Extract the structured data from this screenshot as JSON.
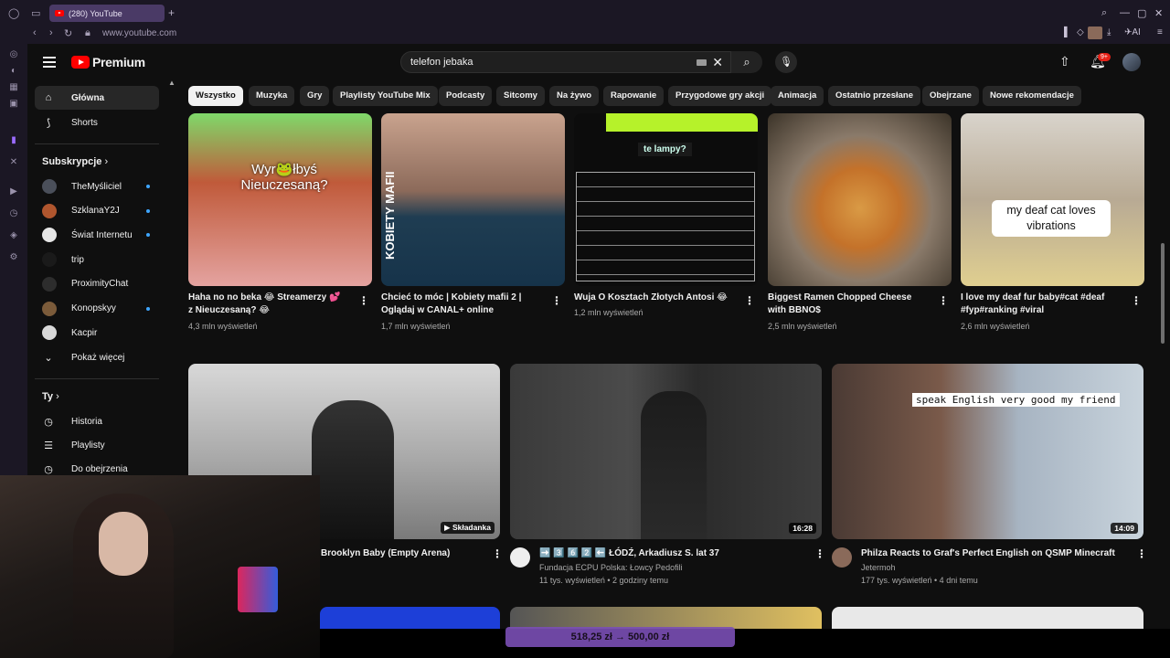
{
  "browser": {
    "tab_title": "(280) YouTube",
    "new_tab": "+",
    "url": "www.youtube.com",
    "ai_label": "AI"
  },
  "header": {
    "logo_text": "Premium",
    "search_value": "telefon jebaka",
    "notifications_badge": "9+"
  },
  "sidebar": {
    "items": [
      {
        "label": "Główna",
        "icon": "home-icon"
      },
      {
        "label": "Shorts",
        "icon": "shorts-icon"
      }
    ],
    "subscriptions_heading": "Subskrypcje",
    "subscriptions": [
      {
        "label": "TheMyśliciel",
        "color": "#4a4f5a",
        "dot": true
      },
      {
        "label": "SzklanaY2J",
        "color": "#b0562e",
        "dot": true
      },
      {
        "label": "Świat Internetu",
        "color": "#e6e6e6",
        "dot": true
      },
      {
        "label": "trip",
        "color": "#1a1a1a",
        "dot": false
      },
      {
        "label": "ProximityChat",
        "color": "#2d2d2d",
        "dot": false
      },
      {
        "label": "Konopskyy",
        "color": "#7b5b3a",
        "dot": true
      },
      {
        "label": "Kacpir",
        "color": "#d8d8d8",
        "dot": false
      }
    ],
    "show_more": "Pokaż więcej",
    "you_heading": "Ty",
    "you_items": [
      {
        "label": "Historia"
      },
      {
        "label": "Playlisty"
      },
      {
        "label": "Do obejrzenia"
      }
    ]
  },
  "chips": [
    "Wszystko",
    "Muzyka",
    "Gry",
    "Playlisty YouTube Mix",
    "Podcasty",
    "Sitcomy",
    "Na żywo",
    "Rapowanie",
    "Przygodowe gry akcji",
    "Animacja",
    "Ostatnio przesłane",
    "Obejrzane",
    "Nowe rekomendacje"
  ],
  "row1": [
    {
      "title1": "Haha no no beka 😂 Streamerzy 💕",
      "title2": "z Nieuczesaną? 😂",
      "meta": "4,3 mln wyświetleń",
      "overlay": "Wyr🐸łbyś\nNieuczesaną?"
    },
    {
      "title1": "Chcieć to móc | Kobiety mafii 2 |",
      "title2": "Oglądaj w CANAL+ online",
      "meta": "1,7 mln wyświetleń",
      "overlay": "KOBIETY MAFII"
    },
    {
      "title1": "Wuja O Kosztach Złotych Antosi 😂",
      "title2": "",
      "meta": "1,2 mln wyświetleń",
      "overlay": "te lampy?"
    },
    {
      "title1": "Biggest Ramen Chopped Cheese",
      "title2": "with BBNO$",
      "meta": "2,5 mln wyświetleń",
      "overlay": ""
    },
    {
      "title1": "I love my deaf fur baby#cat #deaf",
      "title2": "#fyp#ranking #viral",
      "meta": "2,6 mln wyświetleń",
      "overlay": "my deaf cat loves\nvibrations"
    }
  ],
  "row2": [
    {
      "title": "Brooklyn Baby (Empty Arena)",
      "channel": "",
      "meta": "",
      "badge": "Składanka"
    },
    {
      "title": "➡️ 3️⃣ 6️⃣ 2️⃣ ⬅️ ŁÓDŹ, Arkadiusz S. lat 37",
      "channel": "Fundacja ECPU Polska: Łowcy Pedofili",
      "meta": "11 tys. wyświetleń • 2 godziny temu",
      "badge": "16:28"
    },
    {
      "title": "Philza Reacts to Graf's Perfect English on QSMP Minecraft",
      "channel": "Jetermoh",
      "meta": "177 tys. wyświetleń • 4 dni temu",
      "badge": "14:09",
      "overlay": "speak English very good my friend"
    }
  ],
  "price_overlay": "518,25 zł → 500,00 zł"
}
